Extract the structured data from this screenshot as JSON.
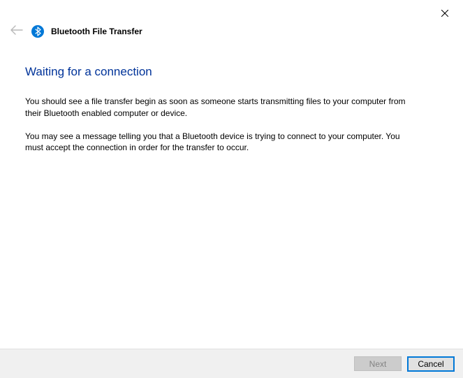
{
  "window": {
    "title": "Bluetooth File Transfer"
  },
  "page": {
    "heading": "Waiting for a connection",
    "paragraph1": "You should see a file transfer begin as soon as someone starts transmitting files to your computer from their Bluetooth enabled computer or device.",
    "paragraph2": "You may see a message telling you that a Bluetooth device is trying to connect to your computer. You must accept the connection in order for the transfer to occur."
  },
  "footer": {
    "next_label": "Next",
    "cancel_label": "Cancel"
  }
}
